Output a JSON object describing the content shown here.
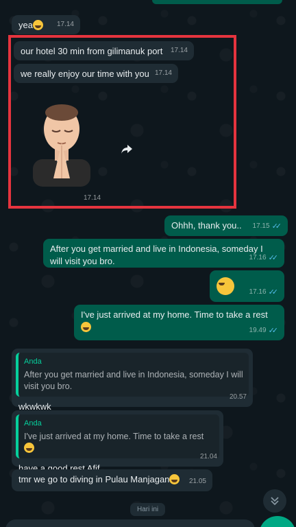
{
  "messages": [
    {
      "text": "yea",
      "time": "17.14"
    },
    {
      "text": "our hotel 30 min from gilimanuk port",
      "time": "17.14"
    },
    {
      "text": "we really enjoy our time with you",
      "time": "17.14"
    },
    {
      "sticker": "praying-memoji-sticker",
      "time": "17.14"
    },
    {
      "text": "Ohhh, thank you..",
      "time": "17.15"
    },
    {
      "text": "After you get married and live in Indonesia, someday I will visit you bro.",
      "time": "17.16"
    },
    {
      "emoji": "laughing-sweat-emoji",
      "time": "17.16"
    },
    {
      "text": "I've just arrived at my home. Time to take a rest",
      "time": "19.49"
    },
    {
      "quote_author": "Anda",
      "quote_text": "After you get married and live in Indonesia, someday I will visit you bro.",
      "text": "wkwkwk",
      "time": "20.57"
    },
    {
      "quote_author": "Anda",
      "quote_text": "I've just arrived at my home. Time to take a rest",
      "text": "have a good rest Afif",
      "time": "21.04"
    },
    {
      "text": "tmr we go to diving in Pulau Manjagan",
      "time": "21.05"
    }
  ],
  "date_chip": "Hari ini",
  "colors": {
    "incoming": "#1f2c34",
    "outgoing": "#005c4b",
    "accent": "#00a884",
    "read_ticks": "#53bdeb",
    "highlight_border": "#e5343e"
  }
}
